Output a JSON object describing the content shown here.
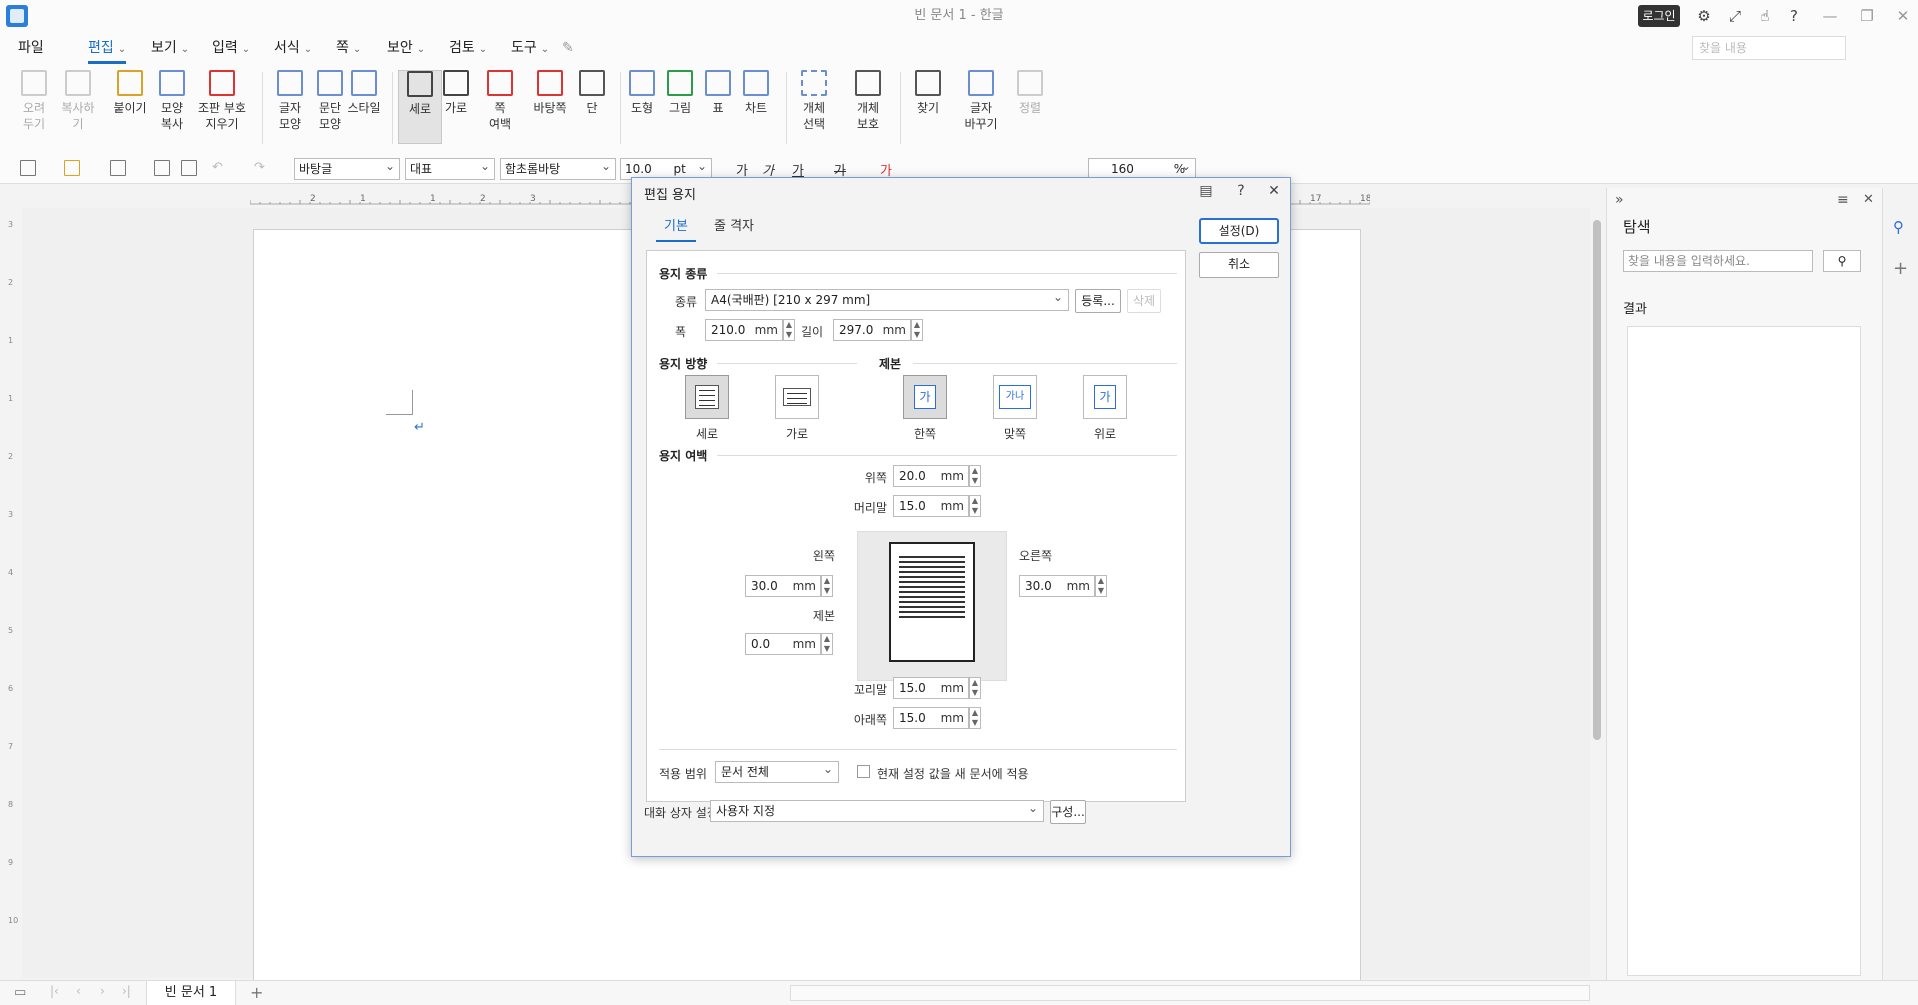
{
  "window": {
    "title": "빈 문서 1 - 한글",
    "login": "로그인",
    "search_placeholder": "찾을 내용"
  },
  "menu": {
    "items": [
      "파일",
      "편집",
      "보기",
      "입력",
      "서식",
      "쪽",
      "보안",
      "검토",
      "도구"
    ]
  },
  "ribbon": {
    "buttons": [
      {
        "label": "오려\n두기",
        "disabled": true
      },
      {
        "label": "복사하기",
        "disabled": true
      },
      {
        "label": "붙이기"
      },
      {
        "label": "모양\n복사"
      },
      {
        "label": "조판 부호\n지우기"
      },
      {
        "label": "글자\n모양"
      },
      {
        "label": "문단\n모양"
      },
      {
        "label": "스타일"
      },
      {
        "label": "세로",
        "active": true
      },
      {
        "label": "가로"
      },
      {
        "label": "쪽\n여백"
      },
      {
        "label": "바탕쪽"
      },
      {
        "label": "단"
      },
      {
        "label": "도형"
      },
      {
        "label": "그림"
      },
      {
        "label": "표"
      },
      {
        "label": "차트"
      },
      {
        "label": "개체\n선택"
      },
      {
        "label": "개체\n보호"
      },
      {
        "label": "찾기"
      },
      {
        "label": "글자\n바꾸기"
      },
      {
        "label": "정렬",
        "disabled": true
      }
    ]
  },
  "format_bar": {
    "style": "바탕글",
    "lang": "대표",
    "font": "함초롬바탕",
    "size": "10.0",
    "size_unit": "pt",
    "line_spacing": "160",
    "line_spacing_unit": "%",
    "char_buttons": [
      "가",
      "가",
      "가",
      "가",
      "가"
    ]
  },
  "ruler": {
    "h_numbers": [
      "2",
      "1",
      "1",
      "2",
      "3",
      "17",
      "18"
    ],
    "v_numbers": [
      "3",
      "2",
      "1",
      "1",
      "2",
      "3",
      "4",
      "5",
      "6",
      "7",
      "8",
      "9",
      "10"
    ]
  },
  "document": {
    "tab_name": "빈 문서 1",
    "paragraph_mark": "↵"
  },
  "side_panel": {
    "title": "탐색",
    "search_placeholder": "찾을 내용을 입력하세요.",
    "result_label": "결과"
  },
  "dialog": {
    "title": "편집 용지",
    "tabs": [
      "기본",
      "줄 격자"
    ],
    "ok": "설정(D)",
    "cancel": "취소",
    "paper_section": "용지 종류",
    "type_label": "종류",
    "type_value": "A4(국배판) [210 x 297 mm]",
    "register": "등록...",
    "delete": "삭제",
    "width_label": "폭",
    "width_value": "210.0",
    "length_label": "길이",
    "length_value": "297.0",
    "unit": "mm",
    "orientation_section": "용지 방향",
    "orientation_options": [
      "세로",
      "가로"
    ],
    "binding_section": "제본",
    "binding_options": [
      "한쪽",
      "맞쪽",
      "위로"
    ],
    "binding_glyphs": [
      "가",
      "가나",
      "가"
    ],
    "margin_section": "용지 여백",
    "top_label": "위쪽",
    "top_value": "20.0",
    "header_label": "머리말",
    "header_value": "15.0",
    "left_label": "왼쪽",
    "left_value": "30.0",
    "right_label": "오른쪽",
    "right_value": "30.0",
    "gutter_label": "제본",
    "gutter_value": "0.0",
    "footer_label": "꼬리말",
    "footer_value": "15.0",
    "bottom_label": "아래쪽",
    "bottom_value": "15.0",
    "apply_label": "적용 범위",
    "apply_value": "문서 전체",
    "apply_new_doc": "현재 설정 값을 새 문서에 적용",
    "dialog_setting_label": "대화 상자 설정",
    "dialog_setting_value": "사용자 지정",
    "configure": "구성..."
  }
}
